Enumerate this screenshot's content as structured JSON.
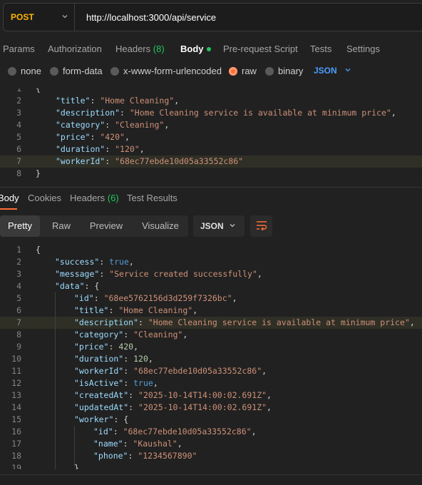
{
  "request": {
    "method": "POST",
    "url": "http://localhost:3000/api/service",
    "tabs": {
      "params": "Params",
      "authorization": "Authorization",
      "headers": "Headers",
      "headers_count": "(8)",
      "body": "Body",
      "prerequest": "Pre-request Script",
      "tests": "Tests",
      "settings": "Settings"
    },
    "body_types": {
      "none": "none",
      "form_data": "form-data",
      "urlencoded": "x-www-form-urlencoded",
      "raw": "raw",
      "binary": "binary",
      "json": "JSON",
      "selected": "raw"
    }
  },
  "response": {
    "tabs": {
      "body": "Body",
      "cookies": "Cookies",
      "headers": "Headers",
      "headers_count": "(6)",
      "test_results": "Test Results"
    },
    "views": {
      "pretty": "Pretty",
      "raw": "Raw",
      "preview": "Preview",
      "visualize": "Visualize",
      "format": "JSON"
    }
  },
  "colors": {
    "method": "#ffb400",
    "accent": "#ff6c37",
    "link": "#4b9dff",
    "success": "#22c55e"
  },
  "request_lines": [
    {
      "n": "1",
      "indent": 0,
      "parts": [
        [
          "p",
          "{"
        ]
      ]
    },
    {
      "n": "2",
      "indent": 1,
      "parts": [
        [
          "k",
          "\"title\""
        ],
        [
          "p",
          ": "
        ],
        [
          "s",
          "\"Home Cleaning\""
        ],
        [
          "p",
          ","
        ]
      ]
    },
    {
      "n": "3",
      "indent": 1,
      "parts": [
        [
          "k",
          "\"description\""
        ],
        [
          "p",
          ": "
        ],
        [
          "s",
          "\"Home Cleaning service is available at minimum price\""
        ],
        [
          "p",
          ","
        ]
      ]
    },
    {
      "n": "4",
      "indent": 1,
      "parts": [
        [
          "k",
          "\"category\""
        ],
        [
          "p",
          ": "
        ],
        [
          "s",
          "\"Cleaning\""
        ],
        [
          "p",
          ","
        ]
      ]
    },
    {
      "n": "5",
      "indent": 1,
      "parts": [
        [
          "k",
          "\"price\""
        ],
        [
          "p",
          ": "
        ],
        [
          "s",
          "\"420\""
        ],
        [
          "p",
          ","
        ]
      ]
    },
    {
      "n": "6",
      "indent": 1,
      "parts": [
        [
          "k",
          "\"duration\""
        ],
        [
          "p",
          ": "
        ],
        [
          "s",
          "\"120\""
        ],
        [
          "p",
          ","
        ]
      ]
    },
    {
      "n": "7",
      "indent": 1,
      "hl": true,
      "parts": [
        [
          "k",
          "\"workerId\""
        ],
        [
          "p",
          ": "
        ],
        [
          "s",
          "\"68ec77ebde10d05a33552c86\""
        ]
      ]
    },
    {
      "n": "8",
      "indent": 0,
      "parts": [
        [
          "p",
          "}"
        ]
      ]
    }
  ],
  "response_lines": [
    {
      "n": "1",
      "indent": 0,
      "parts": [
        [
          "p",
          "{"
        ]
      ]
    },
    {
      "n": "2",
      "indent": 1,
      "parts": [
        [
          "k",
          "\"success\""
        ],
        [
          "p",
          ": "
        ],
        [
          "b",
          "true"
        ],
        [
          "p",
          ","
        ]
      ]
    },
    {
      "n": "3",
      "indent": 1,
      "parts": [
        [
          "k",
          "\"message\""
        ],
        [
          "p",
          ": "
        ],
        [
          "s",
          "\"Service created successfully\""
        ],
        [
          "p",
          ","
        ]
      ]
    },
    {
      "n": "4",
      "indent": 1,
      "parts": [
        [
          "k",
          "\"data\""
        ],
        [
          "p",
          ": {"
        ]
      ]
    },
    {
      "n": "5",
      "indent": 2,
      "parts": [
        [
          "k",
          "\"id\""
        ],
        [
          "p",
          ": "
        ],
        [
          "s",
          "\"68ee5762156d3d259f7326bc\""
        ],
        [
          "p",
          ","
        ]
      ]
    },
    {
      "n": "6",
      "indent": 2,
      "parts": [
        [
          "k",
          "\"title\""
        ],
        [
          "p",
          ": "
        ],
        [
          "s",
          "\"Home Cleaning\""
        ],
        [
          "p",
          ","
        ]
      ]
    },
    {
      "n": "7",
      "indent": 2,
      "hl": true,
      "parts": [
        [
          "k",
          "\"description\""
        ],
        [
          "p",
          ": "
        ],
        [
          "s",
          "\"Home Cleaning service is available at minimum price\""
        ],
        [
          "p",
          ","
        ]
      ]
    },
    {
      "n": "8",
      "indent": 2,
      "parts": [
        [
          "k",
          "\"category\""
        ],
        [
          "p",
          ": "
        ],
        [
          "s",
          "\"Cleaning\""
        ],
        [
          "p",
          ","
        ]
      ]
    },
    {
      "n": "9",
      "indent": 2,
      "parts": [
        [
          "k",
          "\"price\""
        ],
        [
          "p",
          ": "
        ],
        [
          "n",
          "420"
        ],
        [
          "p",
          ","
        ]
      ]
    },
    {
      "n": "10",
      "indent": 2,
      "parts": [
        [
          "k",
          "\"duration\""
        ],
        [
          "p",
          ": "
        ],
        [
          "n",
          "120"
        ],
        [
          "p",
          ","
        ]
      ]
    },
    {
      "n": "11",
      "indent": 2,
      "parts": [
        [
          "k",
          "\"workerId\""
        ],
        [
          "p",
          ": "
        ],
        [
          "s",
          "\"68ec77ebde10d05a33552c86\""
        ],
        [
          "p",
          ","
        ]
      ]
    },
    {
      "n": "12",
      "indent": 2,
      "parts": [
        [
          "k",
          "\"isActive\""
        ],
        [
          "p",
          ": "
        ],
        [
          "b",
          "true"
        ],
        [
          "p",
          ","
        ]
      ]
    },
    {
      "n": "13",
      "indent": 2,
      "parts": [
        [
          "k",
          "\"createdAt\""
        ],
        [
          "p",
          ": "
        ],
        [
          "s",
          "\"2025-10-14T14:00:02.691Z\""
        ],
        [
          "p",
          ","
        ]
      ]
    },
    {
      "n": "14",
      "indent": 2,
      "parts": [
        [
          "k",
          "\"updatedAt\""
        ],
        [
          "p",
          ": "
        ],
        [
          "s",
          "\"2025-10-14T14:00:02.691Z\""
        ],
        [
          "p",
          ","
        ]
      ]
    },
    {
      "n": "15",
      "indent": 2,
      "parts": [
        [
          "k",
          "\"worker\""
        ],
        [
          "p",
          ": {"
        ]
      ]
    },
    {
      "n": "16",
      "indent": 3,
      "parts": [
        [
          "k",
          "\"id\""
        ],
        [
          "p",
          ": "
        ],
        [
          "s",
          "\"68ec77ebde10d05a33552c86\""
        ],
        [
          "p",
          ","
        ]
      ]
    },
    {
      "n": "17",
      "indent": 3,
      "parts": [
        [
          "k",
          "\"name\""
        ],
        [
          "p",
          ": "
        ],
        [
          "s",
          "\"Kaushal\""
        ],
        [
          "p",
          ","
        ]
      ]
    },
    {
      "n": "18",
      "indent": 3,
      "parts": [
        [
          "k",
          "\"phone\""
        ],
        [
          "p",
          ": "
        ],
        [
          "s",
          "\"1234567890\""
        ]
      ]
    },
    {
      "n": "19",
      "indent": 2,
      "parts": [
        [
          "p",
          "}"
        ]
      ]
    }
  ]
}
